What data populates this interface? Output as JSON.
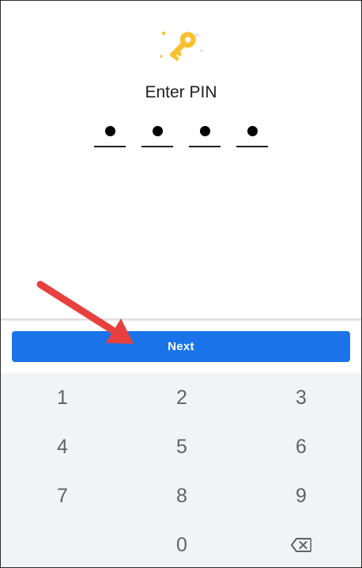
{
  "header": {
    "title": "Enter PIN",
    "icon": "key-icon"
  },
  "pin": {
    "digits_entered": 4,
    "length": 4
  },
  "action": {
    "next_label": "Next"
  },
  "keypad": {
    "rows": [
      [
        "1",
        "2",
        "3"
      ],
      [
        "4",
        "5",
        "6"
      ],
      [
        "7",
        "8",
        "9"
      ],
      [
        "",
        "0",
        "backspace-icon"
      ]
    ]
  },
  "colors": {
    "accent": "#1a73e8",
    "key_icon": "#f9c02d",
    "keyboard_bg": "#f1f3f4",
    "annotation_arrow": "#e8403f"
  }
}
